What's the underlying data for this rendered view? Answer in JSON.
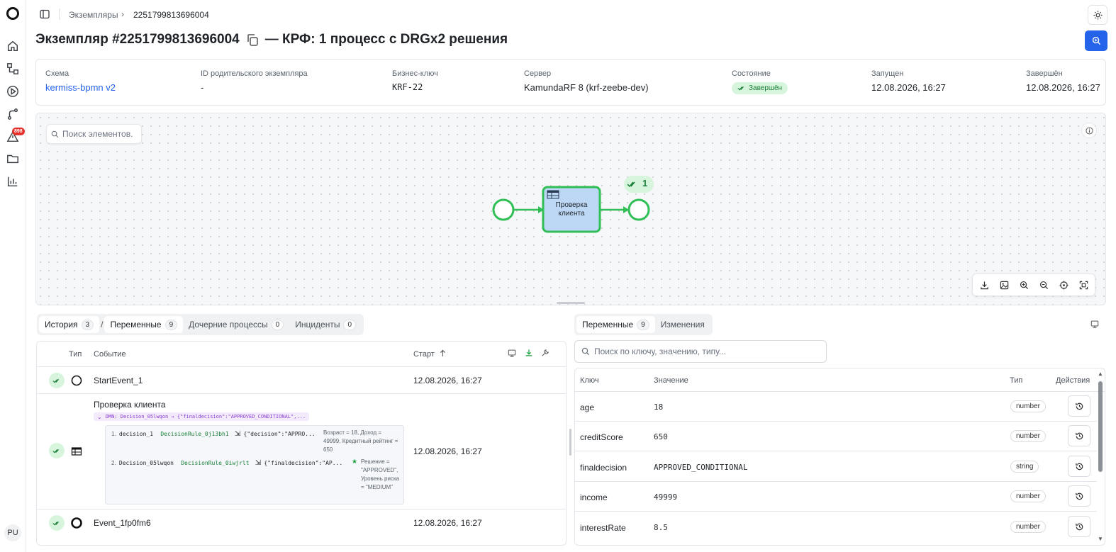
{
  "breadcrumb": {
    "section": "Экземпляры",
    "current": "2251799813696004"
  },
  "page": {
    "title_prefix": "Экземпляр #2251799813696004",
    "title_suffix": "— КРФ: 1 процесс с DRGx2 решения"
  },
  "rail": {
    "alerts_badge": "898",
    "user_initials": "PU"
  },
  "info": {
    "schema_label": "Схема",
    "schema_value": "kermiss-bpmn v2",
    "parent_label": "ID родительского экземпляра",
    "parent_value": "-",
    "bkey_label": "Бизнес-ключ",
    "bkey_value": "KRF-22",
    "server_label": "Сервер",
    "server_value": "KamundaRF 8 (krf-zeebe-dev)",
    "state_label": "Состояние",
    "state_value": "Завершён",
    "started_label": "Запущен",
    "started_value": "12.08.2026, 16:27",
    "finished_label": "Завершён",
    "finished_value": "12.08.2026, 16:27"
  },
  "canvas": {
    "search_placeholder": "Поиск элементов...",
    "task_label_line1": "Проверка",
    "task_label_line2": "клиента",
    "end_badge_count": "1"
  },
  "left_tabs": [
    {
      "label": "История",
      "count": "3"
    },
    {
      "label": "Переменные",
      "count": "9"
    },
    {
      "label": "Дочерние процессы",
      "count": "0"
    },
    {
      "label": "Инциденты",
      "count": "0"
    }
  ],
  "history": {
    "col_type": "Тип",
    "col_event": "Событие",
    "col_start": "Старт",
    "rows": [
      {
        "name": "StartEvent_1",
        "time": "12.08.2026, 16:27"
      },
      {
        "name": "Проверка клиента",
        "time": "12.08.2026, 16:27"
      },
      {
        "name": "Event_1fp0fm6",
        "time": "12.08.2026, 16:27"
      }
    ],
    "dmn_chip": "DMN: Decision_05lwqon → {\"finaldecision\":\"APPROVED_CONDITIONAL\",...",
    "decisions": [
      {
        "index": "1.",
        "name": "decision_1",
        "rule": "DecisionRule_0j13bh1",
        "output": "{\"decision\":\"APPRO...",
        "note": "Возраст = 18, Доход = 49999, Кредитный рейтинг = 650"
      },
      {
        "index": "2.",
        "name": "Decision_05lwqon",
        "rule": "DecisionRule_0iwjrlt",
        "output": "{\"finaldecision\":\"AP...",
        "note": "Решение = \"APPROVED\", Уровень риска = \"MEDIUM\""
      }
    ]
  },
  "right_tabs": [
    {
      "label": "Переменные",
      "count": "9"
    },
    {
      "label": "Изменения",
      "count": ""
    }
  ],
  "variables": {
    "search_placeholder": "Поиск по ключу, значению, типу...",
    "col_key": "Ключ",
    "col_value": "Значение",
    "col_type": "Тип",
    "col_actions": "Действия",
    "rows": [
      {
        "key": "age",
        "value": "18",
        "type": "number"
      },
      {
        "key": "creditScore",
        "value": "650",
        "type": "number"
      },
      {
        "key": "finaldecision",
        "value": "APPROVED_CONDITIONAL",
        "type": "string"
      },
      {
        "key": "income",
        "value": "49999",
        "type": "number"
      },
      {
        "key": "interestRate",
        "value": "8.5",
        "type": "number"
      }
    ]
  },
  "colors": {
    "accent": "#2563eb",
    "success": "#1a7f37",
    "success_bg": "#d7f5dd",
    "bpmn_green": "#2fbf55",
    "task_fill": "#bcd8f5"
  }
}
